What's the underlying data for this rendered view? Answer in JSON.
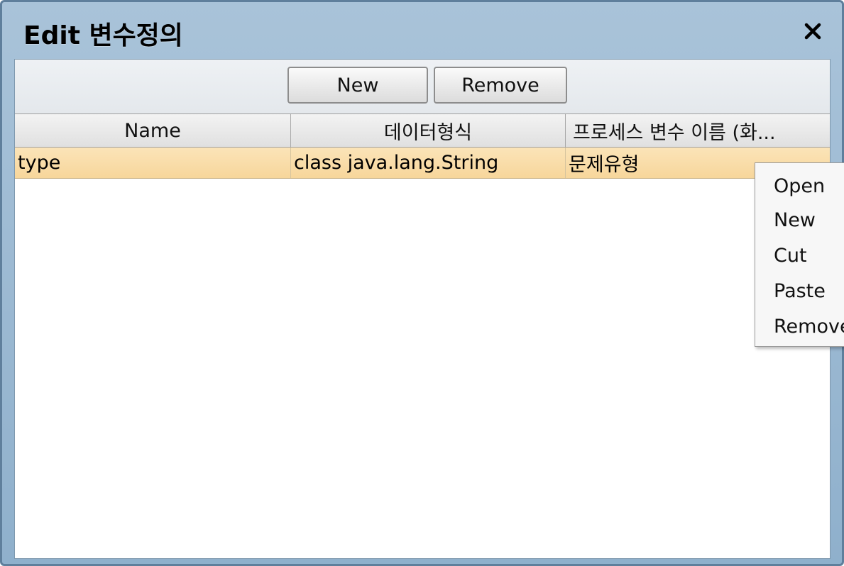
{
  "window": {
    "title": "Edit 변수정의",
    "close_icon": "close-icon"
  },
  "toolbar": {
    "new_label": "New",
    "remove_label": "Remove"
  },
  "table": {
    "columns": [
      "Name",
      "데이터형식",
      "프로세스 변수 이름 (화..."
    ],
    "rows": [
      {
        "name": "type",
        "data_type": "class java.lang.String",
        "process_var": "문제유형",
        "selected": true
      }
    ]
  },
  "context_menu": {
    "items": [
      "Open",
      "New",
      "Cut",
      "Paste",
      "Remove"
    ]
  },
  "colors": {
    "title_bar": "#9bb8d2",
    "selected_row": "#f9dca8",
    "header_bg": "#e8e8e8"
  }
}
